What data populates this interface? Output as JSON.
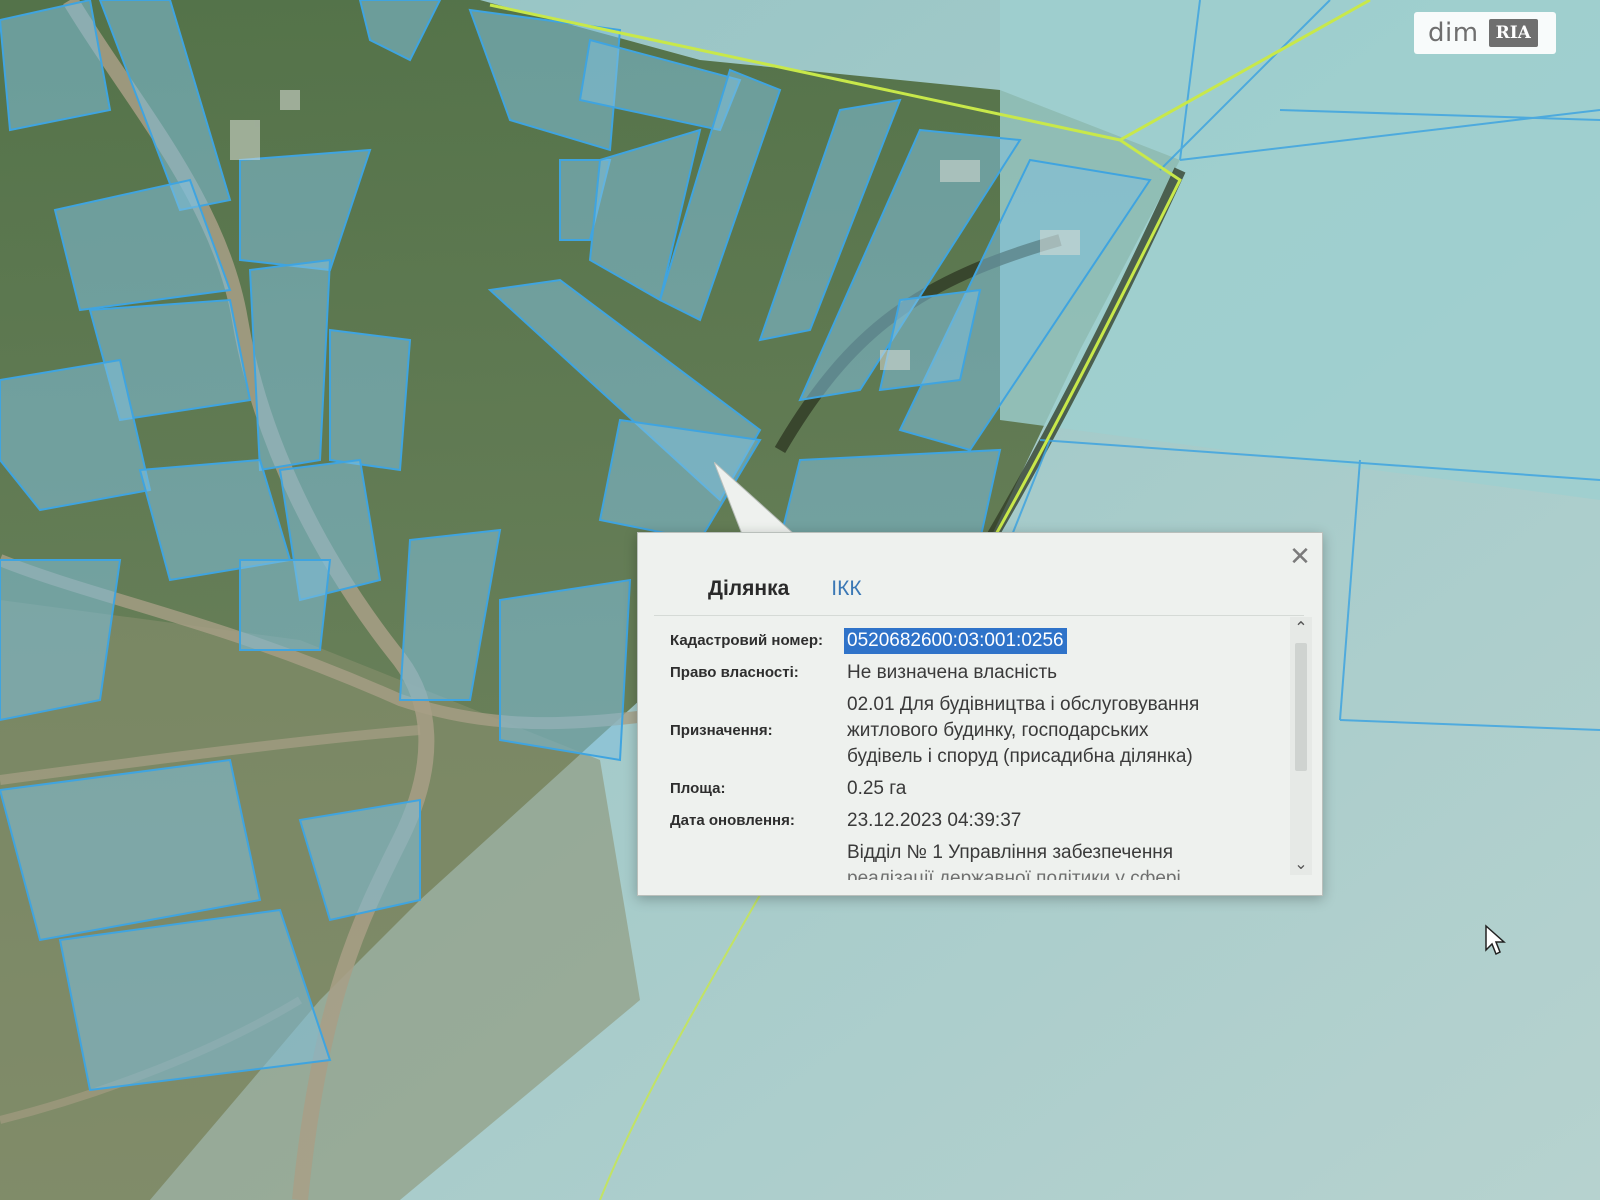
{
  "watermark": {
    "brand": "dim",
    "badge": "RIA"
  },
  "popup": {
    "tabs": [
      {
        "label": "Ділянка",
        "active": true
      },
      {
        "label": "ІКК",
        "active": false
      }
    ],
    "close_icon": "close-icon",
    "fields": {
      "cadastral_label": "Кадастровий номер:",
      "cadastral_value": "0520682600:03:001:0256",
      "ownership_label": "Право власності:",
      "ownership_value": "Не визначена власність",
      "purpose_label": "Призначення:",
      "purpose_line1": "02.01 Для будівництва і обслуговування",
      "purpose_line2": "житлового будинку, господарських",
      "purpose_line3": "будівель і споруд (присадибна ділянка)",
      "area_label": "Площа:",
      "area_value": "0.25 га",
      "updated_label": "Дата оновлення:",
      "updated_value": "23.12.2023 04:39:37",
      "department_line1": "Відділ № 1 Управління забезпечення",
      "department_line2": "реалізації державної політики у сфері"
    }
  },
  "colors": {
    "parcel_fill": "#7fc0dd",
    "parcel_stroke": "#3fa4e0",
    "boundary_line": "#c8e84a",
    "selection": "#2f73c9"
  }
}
